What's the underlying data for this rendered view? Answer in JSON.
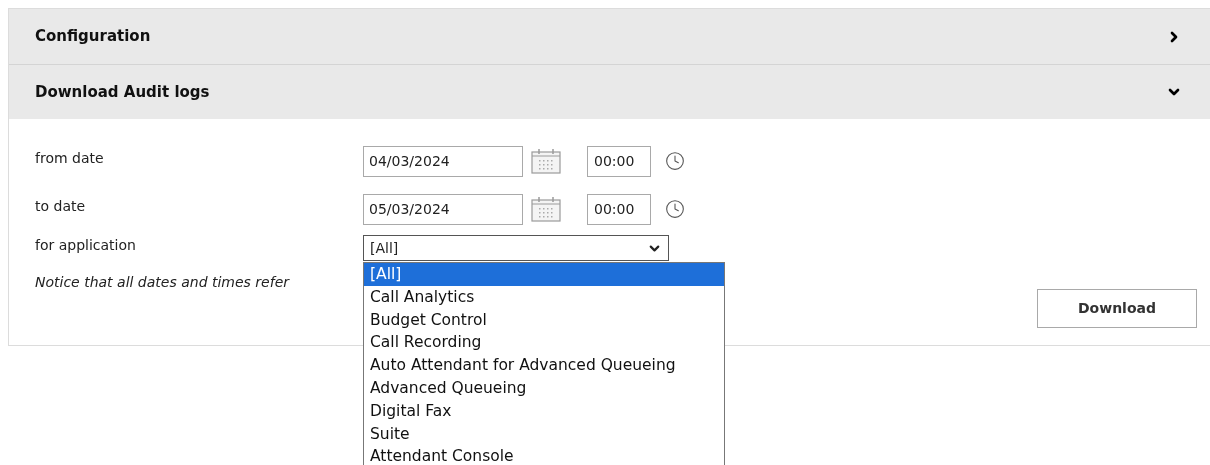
{
  "sections": [
    {
      "title": "Configuration",
      "expanded": false
    },
    {
      "title": "Download Audit logs",
      "expanded": true,
      "content": {
        "rows": [
          {
            "label": "from date",
            "date": "04/03/2024",
            "time": "00:00"
          },
          {
            "label": "to date",
            "date": "05/03/2024",
            "time": "00:00"
          }
        ],
        "application": {
          "label": "for application",
          "value": "[All]",
          "expanded": true,
          "options": [
            {
              "label": "[All]",
              "selected": true
            },
            {
              "label": "Call Analytics",
              "selected": false
            },
            {
              "label": "Budget Control",
              "selected": false
            },
            {
              "label": "Call Recording",
              "selected": false
            },
            {
              "label": "Auto Attendant for Advanced Queueing",
              "selected": false
            },
            {
              "label": "Advanced Queueing",
              "selected": false
            },
            {
              "label": "Digital Fax",
              "selected": false
            },
            {
              "label": "Suite",
              "selected": false
            },
            {
              "label": "Attendant Console",
              "selected": false
            }
          ]
        },
        "notice": "Notice that all dates and times refer",
        "download_button": "Download"
      }
    }
  ]
}
